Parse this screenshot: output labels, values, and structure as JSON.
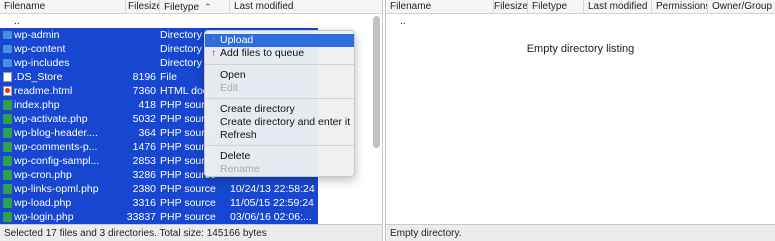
{
  "local": {
    "columns": [
      "Filename",
      "Filesize",
      "Filetype",
      "Last modified"
    ],
    "sort_indicator": "⌃",
    "rows": [
      {
        "name": "..",
        "size": "",
        "type": "",
        "modified": "",
        "icon": "parent-dir-icon",
        "selected": false
      },
      {
        "name": "wp-admin",
        "size": "",
        "type": "Directory",
        "modified": "",
        "icon": "folder-icon",
        "selected": true
      },
      {
        "name": "wp-content",
        "size": "",
        "type": "Directory",
        "modified": "",
        "icon": "folder-icon",
        "selected": true
      },
      {
        "name": "wp-includes",
        "size": "",
        "type": "Directory",
        "modified": "",
        "icon": "folder-icon",
        "selected": true
      },
      {
        "name": ".DS_Store",
        "size": "8196",
        "type": "File",
        "modified": "",
        "icon": "file-icon",
        "selected": true
      },
      {
        "name": "readme.html",
        "size": "7360",
        "type": "HTML doc",
        "modified": "",
        "icon": "html-file-icon",
        "selected": true
      },
      {
        "name": "index.php",
        "size": "418",
        "type": "PHP source",
        "modified": "",
        "icon": "php-file-icon",
        "selected": true
      },
      {
        "name": "wp-activate.php",
        "size": "5032",
        "type": "PHP source",
        "modified": "",
        "icon": "php-file-icon",
        "selected": true
      },
      {
        "name": "wp-blog-header....",
        "size": "364",
        "type": "PHP source",
        "modified": "",
        "icon": "php-file-icon",
        "selected": true
      },
      {
        "name": "wp-comments-p...",
        "size": "1476",
        "type": "PHP source",
        "modified": "",
        "icon": "php-file-icon",
        "selected": true
      },
      {
        "name": "wp-config-sampl...",
        "size": "2853",
        "type": "PHP source",
        "modified": "",
        "icon": "php-file-icon",
        "selected": true
      },
      {
        "name": "wp-cron.php",
        "size": "3286",
        "type": "PHP source",
        "modified": "",
        "icon": "php-file-icon",
        "selected": true
      },
      {
        "name": "wp-links-opml.php",
        "size": "2380",
        "type": "PHP source",
        "modified": "10/24/13 22:58:24",
        "icon": "php-file-icon",
        "selected": true
      },
      {
        "name": "wp-load.php",
        "size": "3316",
        "type": "PHP source",
        "modified": "11/05/15 22:59:24",
        "icon": "php-file-icon",
        "selected": true
      },
      {
        "name": "wp-login.php",
        "size": "33837",
        "type": "PHP source",
        "modified": "03/06/16 02:06:...",
        "icon": "php-file-icon",
        "selected": true
      }
    ],
    "status": "Selected 17 files and 3 directories. Total size: 145166 bytes"
  },
  "remote": {
    "columns": [
      "Filename",
      "Filesize",
      "Filetype",
      "Last modified",
      "Permissions",
      "Owner/Group"
    ],
    "rows": [
      {
        "name": "..",
        "icon": "parent-dir-icon"
      }
    ],
    "empty_message": "Empty directory listing",
    "status": "Empty directory."
  },
  "context_menu": {
    "items": [
      {
        "label": "Upload",
        "icon": "upload-arrow-icon",
        "highlighted": true,
        "disabled": false
      },
      {
        "label": "Add files to queue",
        "icon": "add-queue-icon",
        "highlighted": false,
        "disabled": false
      },
      {
        "label": "Open",
        "highlighted": false,
        "disabled": false
      },
      {
        "label": "Edit",
        "highlighted": false,
        "disabled": true
      },
      {
        "label": "Create directory",
        "highlighted": false,
        "disabled": false
      },
      {
        "label": "Create directory and enter it",
        "highlighted": false,
        "disabled": false
      },
      {
        "label": "Refresh",
        "highlighted": false,
        "disabled": false
      },
      {
        "label": "Delete",
        "highlighted": false,
        "disabled": false
      },
      {
        "label": "Rename",
        "highlighted": false,
        "disabled": true
      }
    ]
  },
  "colors": {
    "selection": "#1747d0",
    "menu_highlight": "#2e6ddf",
    "php_icon": "#2fa04a",
    "folder_icon": "#4a90d9"
  }
}
